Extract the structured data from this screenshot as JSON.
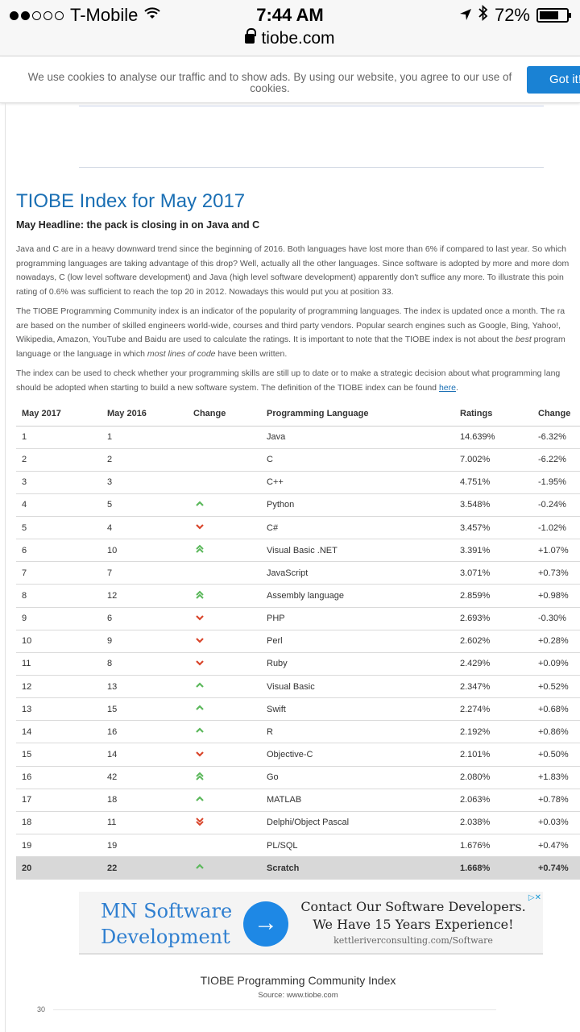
{
  "status_bar": {
    "carrier": "T-Mobile",
    "time": "7:44 AM",
    "battery": "72%",
    "battery_level": 0.72,
    "signal_bars_filled": 2,
    "signal_bars_total": 5
  },
  "url_bar": {
    "domain": "tiobe.com"
  },
  "cookie_banner": {
    "text": "We use cookies to analyse our traffic and to show ads. By using our website, you agree to our use of cookies.",
    "button": "Got it!"
  },
  "article": {
    "title": "TIOBE Index for May 2017",
    "headline": "May Headline: the pack is closing in on Java and C",
    "p1": [
      "Java and C are in a heavy downward trend since the beginning of 2016. Both languages have lost more than 6% if compared to last year. So which",
      "programming languages are taking advantage of this drop? Well, actually all the other languages. Since software is adopted by more and more dom",
      "nowadays, C (low level software development) and Java (high level software development) apparently don't suffice any more. To illustrate this poin",
      "rating of 0.6% was sufficient to reach the top 20 in 2012. Nowadays this would put you at position 33."
    ],
    "p2": [
      "The TIOBE Programming Community index is an indicator of the popularity of programming languages. The index is updated once a month. The ra",
      "are based on the number of skilled engineers world-wide, courses and third party vendors. Popular search engines such as Google, Bing, Yahoo!,",
      "Wikipedia, Amazon, YouTube and Baidu are used to calculate the ratings. It is important to note that the TIOBE index is not about the",
      "best",
      "program",
      "language or the language in which",
      "most lines of code",
      "have been written."
    ],
    "p3": [
      "The index can be used to check whether your programming skills are still up to date or to make a strategic decision about what programming lang",
      "should be adopted when starting to build a new software system. The definition of the TIOBE index can be found",
      "here",
      "."
    ]
  },
  "table": {
    "headers": [
      "May 2017",
      "May 2016",
      "Change",
      "Programming Language",
      "Ratings",
      "Change"
    ],
    "rows": [
      {
        "may2017": "1",
        "may2016": "1",
        "trend": "",
        "language": "Java",
        "rating": "14.639%",
        "change": "-6.32%"
      },
      {
        "may2017": "2",
        "may2016": "2",
        "trend": "",
        "language": "C",
        "rating": "7.002%",
        "change": "-6.22%"
      },
      {
        "may2017": "3",
        "may2016": "3",
        "trend": "",
        "language": "C++",
        "rating": "4.751%",
        "change": "-1.95%"
      },
      {
        "may2017": "4",
        "may2016": "5",
        "trend": "up",
        "language": "Python",
        "rating": "3.548%",
        "change": "-0.24%"
      },
      {
        "may2017": "5",
        "may2016": "4",
        "trend": "down",
        "language": "C#",
        "rating": "3.457%",
        "change": "-1.02%"
      },
      {
        "may2017": "6",
        "may2016": "10",
        "trend": "upup",
        "language": "Visual Basic .NET",
        "rating": "3.391%",
        "change": "+1.07%"
      },
      {
        "may2017": "7",
        "may2016": "7",
        "trend": "",
        "language": "JavaScript",
        "rating": "3.071%",
        "change": "+0.73%"
      },
      {
        "may2017": "8",
        "may2016": "12",
        "trend": "upup",
        "language": "Assembly language",
        "rating": "2.859%",
        "change": "+0.98%"
      },
      {
        "may2017": "9",
        "may2016": "6",
        "trend": "down",
        "language": "PHP",
        "rating": "2.693%",
        "change": "-0.30%"
      },
      {
        "may2017": "10",
        "may2016": "9",
        "trend": "down",
        "language": "Perl",
        "rating": "2.602%",
        "change": "+0.28%"
      },
      {
        "may2017": "11",
        "may2016": "8",
        "trend": "down",
        "language": "Ruby",
        "rating": "2.429%",
        "change": "+0.09%"
      },
      {
        "may2017": "12",
        "may2016": "13",
        "trend": "up",
        "language": "Visual Basic",
        "rating": "2.347%",
        "change": "+0.52%"
      },
      {
        "may2017": "13",
        "may2016": "15",
        "trend": "up",
        "language": "Swift",
        "rating": "2.274%",
        "change": "+0.68%"
      },
      {
        "may2017": "14",
        "may2016": "16",
        "trend": "up",
        "language": "R",
        "rating": "2.192%",
        "change": "+0.86%"
      },
      {
        "may2017": "15",
        "may2016": "14",
        "trend": "down",
        "language": "Objective-C",
        "rating": "2.101%",
        "change": "+0.50%"
      },
      {
        "may2017": "16",
        "may2016": "42",
        "trend": "upup",
        "language": "Go",
        "rating": "2.080%",
        "change": "+1.83%"
      },
      {
        "may2017": "17",
        "may2016": "18",
        "trend": "up",
        "language": "MATLAB",
        "rating": "2.063%",
        "change": "+0.78%"
      },
      {
        "may2017": "18",
        "may2016": "11",
        "trend": "downdown",
        "language": "Delphi/Object Pascal",
        "rating": "2.038%",
        "change": "+0.03%"
      },
      {
        "may2017": "19",
        "may2016": "19",
        "trend": "",
        "language": "PL/SQL",
        "rating": "1.676%",
        "change": "+0.47%"
      },
      {
        "may2017": "20",
        "may2016": "22",
        "trend": "up",
        "language": "Scratch",
        "rating": "1.668%",
        "change": "+0.74%",
        "highlight": true
      }
    ]
  },
  "ad": {
    "brand_line1": "MN Software",
    "brand_line2": "Development",
    "cta_icon": "arrow-right-icon",
    "message": "Contact Our Software Developers. We Have 15 Years Experience!",
    "url": "kettleriverconsulting.com/Software"
  },
  "chart": {
    "title": "TIOBE Programming Community Index",
    "source": "Source: www.tiobe.com",
    "first_tick": "30"
  },
  "colors": {
    "title_blue": "#1a6fb4",
    "button_blue": "#1a82d4",
    "trend_up": "#5bb85b",
    "trend_down": "#d9452b",
    "highlight_row": "#d8d8d8"
  }
}
